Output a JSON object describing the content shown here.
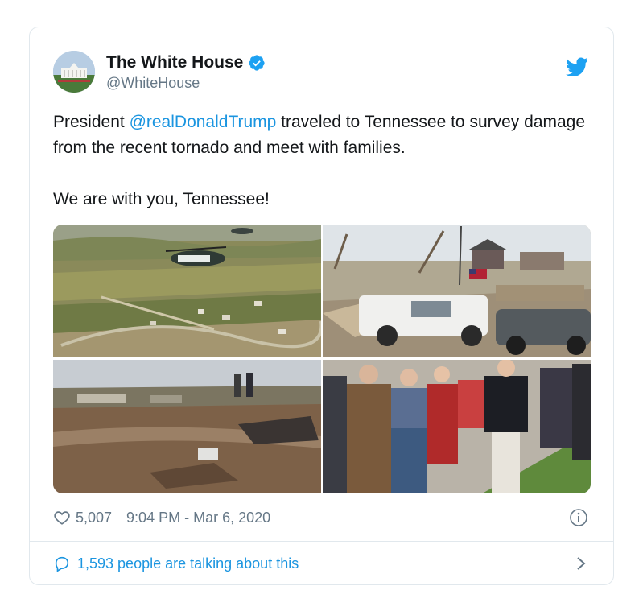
{
  "tweet": {
    "display_name": "The White House",
    "handle": "@WhiteHouse",
    "text_before_mention": "President ",
    "mention": "@realDonaldTrump",
    "text_after_mention": " traveled to Tennessee to survey damage from the recent tornado and meet with families.\n\nWe are with you, Tennessee!",
    "likes": "5,007",
    "timestamp": "9:04 PM - Mar 6, 2020",
    "conversation": "1,593 people are talking about this"
  },
  "icons": {
    "verified": "verified-badge-icon",
    "bird": "twitter-bird-icon",
    "like": "heart-icon",
    "info": "info-icon",
    "reply": "speech-bubble-icon",
    "chevron": "chevron-right-icon"
  },
  "colors": {
    "accent": "#1b95e0",
    "text": "#14171a",
    "muted": "#657786",
    "border": "#e1e8ed"
  }
}
